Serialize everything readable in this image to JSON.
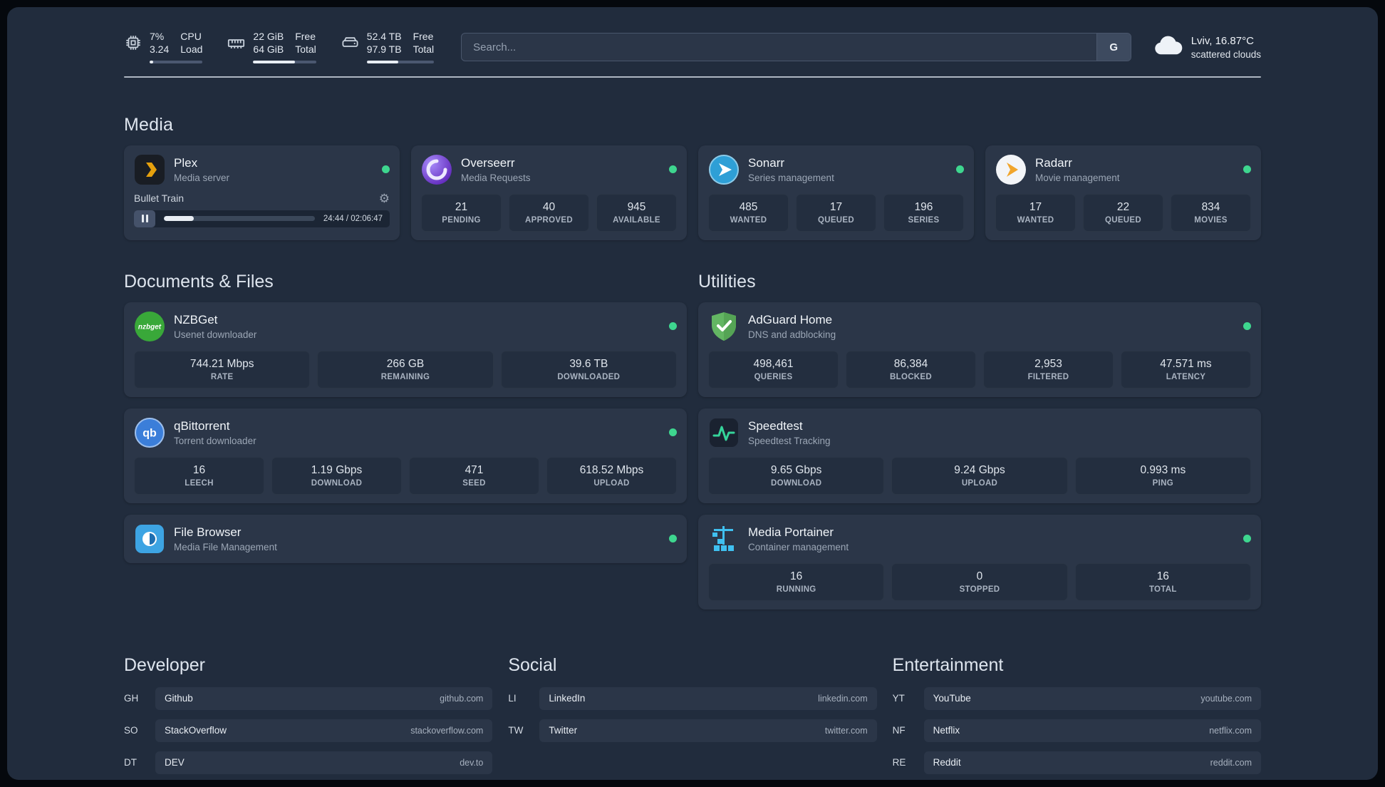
{
  "topbar": {
    "cpu": {
      "value_top": "7%",
      "value_bottom": "3.24",
      "label_top": "CPU",
      "label_bottom": "Load",
      "bar_pct": 7
    },
    "memory": {
      "value_top": "22 GiB",
      "value_bottom": "64 GiB",
      "label_top": "Free",
      "label_bottom": "Total",
      "bar_pct": 66
    },
    "disk": {
      "value_top": "52.4 TB",
      "value_bottom": "97.9 TB",
      "label_top": "Free",
      "label_bottom": "Total",
      "bar_pct": 47
    },
    "search": {
      "placeholder": "Search...",
      "provider_button": "G"
    },
    "weather": {
      "location": "Lviv, 16.87°C",
      "condition": "scattered clouds"
    }
  },
  "section_titles": {
    "media": "Media",
    "documents": "Documents & Files",
    "utilities": "Utilities",
    "developer": "Developer",
    "social": "Social",
    "entertainment": "Entertainment"
  },
  "services": {
    "plex": {
      "name": "Plex",
      "desc": "Media server",
      "player": {
        "title": "Bullet Train",
        "time": "24:44 / 02:06:47",
        "progress_pct": 20
      }
    },
    "overseerr": {
      "name": "Overseerr",
      "desc": "Media Requests",
      "stats": [
        {
          "value": "21",
          "label": "PENDING"
        },
        {
          "value": "40",
          "label": "APPROVED"
        },
        {
          "value": "945",
          "label": "AVAILABLE"
        }
      ]
    },
    "sonarr": {
      "name": "Sonarr",
      "desc": "Series management",
      "stats": [
        {
          "value": "485",
          "label": "WANTED"
        },
        {
          "value": "17",
          "label": "QUEUED"
        },
        {
          "value": "196",
          "label": "SERIES"
        }
      ]
    },
    "radarr": {
      "name": "Radarr",
      "desc": "Movie management",
      "stats": [
        {
          "value": "17",
          "label": "WANTED"
        },
        {
          "value": "22",
          "label": "QUEUED"
        },
        {
          "value": "834",
          "label": "MOVIES"
        }
      ]
    },
    "nzbget": {
      "name": "NZBGet",
      "desc": "Usenet downloader",
      "stats": [
        {
          "value": "744.21 Mbps",
          "label": "RATE"
        },
        {
          "value": "266 GB",
          "label": "REMAINING"
        },
        {
          "value": "39.6 TB",
          "label": "DOWNLOADED"
        }
      ]
    },
    "qbittorrent": {
      "name": "qBittorrent",
      "desc": "Torrent downloader",
      "stats": [
        {
          "value": "16",
          "label": "LEECH"
        },
        {
          "value": "1.19 Gbps",
          "label": "DOWNLOAD"
        },
        {
          "value": "471",
          "label": "SEED"
        },
        {
          "value": "618.52 Mbps",
          "label": "UPLOAD"
        }
      ]
    },
    "filebrowser": {
      "name": "File Browser",
      "desc": "Media File Management"
    },
    "adguard": {
      "name": "AdGuard Home",
      "desc": "DNS and adblocking",
      "stats": [
        {
          "value": "498,461",
          "label": "QUERIES"
        },
        {
          "value": "86,384",
          "label": "BLOCKED"
        },
        {
          "value": "2,953",
          "label": "FILTERED"
        },
        {
          "value": "47.571 ms",
          "label": "LATENCY"
        }
      ]
    },
    "speedtest": {
      "name": "Speedtest",
      "desc": "Speedtest Tracking",
      "stats": [
        {
          "value": "9.65 Gbps",
          "label": "DOWNLOAD"
        },
        {
          "value": "9.24 Gbps",
          "label": "UPLOAD"
        },
        {
          "value": "0.993 ms",
          "label": "PING"
        }
      ]
    },
    "portainer": {
      "name": "Media Portainer",
      "desc": "Container management",
      "stats": [
        {
          "value": "16",
          "label": "RUNNING"
        },
        {
          "value": "0",
          "label": "STOPPED"
        },
        {
          "value": "16",
          "label": "TOTAL"
        }
      ]
    }
  },
  "bookmarks": {
    "developer": [
      {
        "abbr": "GH",
        "name": "Github",
        "domain": "github.com"
      },
      {
        "abbr": "SO",
        "name": "StackOverflow",
        "domain": "stackoverflow.com"
      },
      {
        "abbr": "DT",
        "name": "DEV",
        "domain": "dev.to"
      }
    ],
    "social": [
      {
        "abbr": "LI",
        "name": "LinkedIn",
        "domain": "linkedin.com"
      },
      {
        "abbr": "TW",
        "name": "Twitter",
        "domain": "twitter.com"
      }
    ],
    "entertainment": [
      {
        "abbr": "YT",
        "name": "YouTube",
        "domain": "youtube.com"
      },
      {
        "abbr": "NF",
        "name": "Netflix",
        "domain": "netflix.com"
      },
      {
        "abbr": "RE",
        "name": "Reddit",
        "domain": "reddit.com"
      }
    ]
  },
  "colors": {
    "status_online": "#3ed68f",
    "plex_amber": "#e5a00d"
  }
}
